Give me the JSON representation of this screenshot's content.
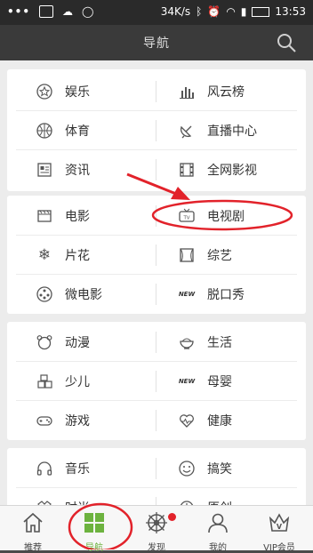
{
  "status_bar": {
    "left_icons": [
      "more-icon",
      "image-icon",
      "cloud-icon",
      "chat-icon"
    ],
    "speed": "34K/s",
    "time": "13:53"
  },
  "header": {
    "title": "导航"
  },
  "sections": [
    {
      "rows": [
        {
          "left": {
            "label": "娱乐",
            "icon": "star-circle-icon"
          },
          "right": {
            "label": "风云榜",
            "icon": "bars-icon"
          }
        },
        {
          "left": {
            "label": "体育",
            "icon": "basketball-icon"
          },
          "right": {
            "label": "直播中心",
            "icon": "satellite-dish-icon"
          }
        },
        {
          "left": {
            "label": "资讯",
            "icon": "news-icon"
          },
          "right": {
            "label": "全网影视",
            "icon": "film-icon"
          }
        }
      ]
    },
    {
      "rows": [
        {
          "left": {
            "label": "电影",
            "icon": "clapperboard-icon"
          },
          "right": {
            "label": "电视剧",
            "icon": "tv-icon"
          }
        },
        {
          "left": {
            "label": "片花",
            "icon": "snowflake-icon"
          },
          "right": {
            "label": "综艺",
            "icon": "stage-icon"
          }
        },
        {
          "left": {
            "label": "微电影",
            "icon": "film-reel-icon"
          },
          "right": {
            "label": "脱口秀",
            "icon": "new-badge-icon"
          }
        }
      ]
    },
    {
      "rows": [
        {
          "left": {
            "label": "动漫",
            "icon": "bear-icon"
          },
          "right": {
            "label": "生活",
            "icon": "bowl-icon"
          }
        },
        {
          "left": {
            "label": "少儿",
            "icon": "blocks-icon"
          },
          "right": {
            "label": "母婴",
            "icon": "new-badge-icon"
          }
        },
        {
          "left": {
            "label": "游戏",
            "icon": "gamepad-icon"
          },
          "right": {
            "label": "健康",
            "icon": "heart-pulse-icon"
          }
        }
      ]
    },
    {
      "rows": [
        {
          "left": {
            "label": "音乐",
            "icon": "headphones-icon"
          },
          "right": {
            "label": "搞笑",
            "icon": "smiley-icon"
          }
        },
        {
          "left": {
            "label": "时尚",
            "icon": "fashion-icon"
          },
          "right": {
            "label": "原创",
            "icon": "original-icon"
          }
        }
      ]
    }
  ],
  "badge_new": "NEW",
  "tv_icon_text": "TV",
  "tabs": [
    {
      "label": "推荐",
      "icon": "home-icon"
    },
    {
      "label": "导航",
      "icon": "grid-icon",
      "active": true
    },
    {
      "label": "发现",
      "icon": "ship-wheel-icon",
      "dot": true
    },
    {
      "label": "我的",
      "icon": "user-icon"
    },
    {
      "label": "VIP会员",
      "icon": "crown-icon"
    }
  ],
  "colors": {
    "accent": "#6db33f",
    "annotation": "#e2222a",
    "header_bg": "#3a3a3a"
  }
}
